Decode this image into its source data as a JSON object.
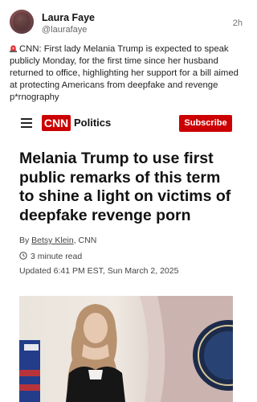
{
  "post": {
    "author_name": "Laura Faye",
    "author_handle": "@laurafaye",
    "timestamp": "2h",
    "text": "CNN: First lady Melania Trump is expected to speak publicly Monday, for the first time since her husband returned to office, highlighting her support for a bill aimed at protecting Americans from deepfake and revenge p*rnography"
  },
  "article": {
    "section": "Politics",
    "subscribe_label": "Subscribe",
    "headline": "Melania Trump to use first public remarks of this term to shine a light on victims of deepfake revenge porn",
    "byline_prefix": "By ",
    "byline_author": "Betsy Klein",
    "byline_suffix": ", CNN",
    "read_time": "3 minute read",
    "updated": "Updated 6:41 PM EST, Sun March 2, 2025"
  },
  "colors": {
    "brand_red": "#cc0000"
  },
  "icons": [
    "siren-icon",
    "menu-icon",
    "clock-icon"
  ]
}
